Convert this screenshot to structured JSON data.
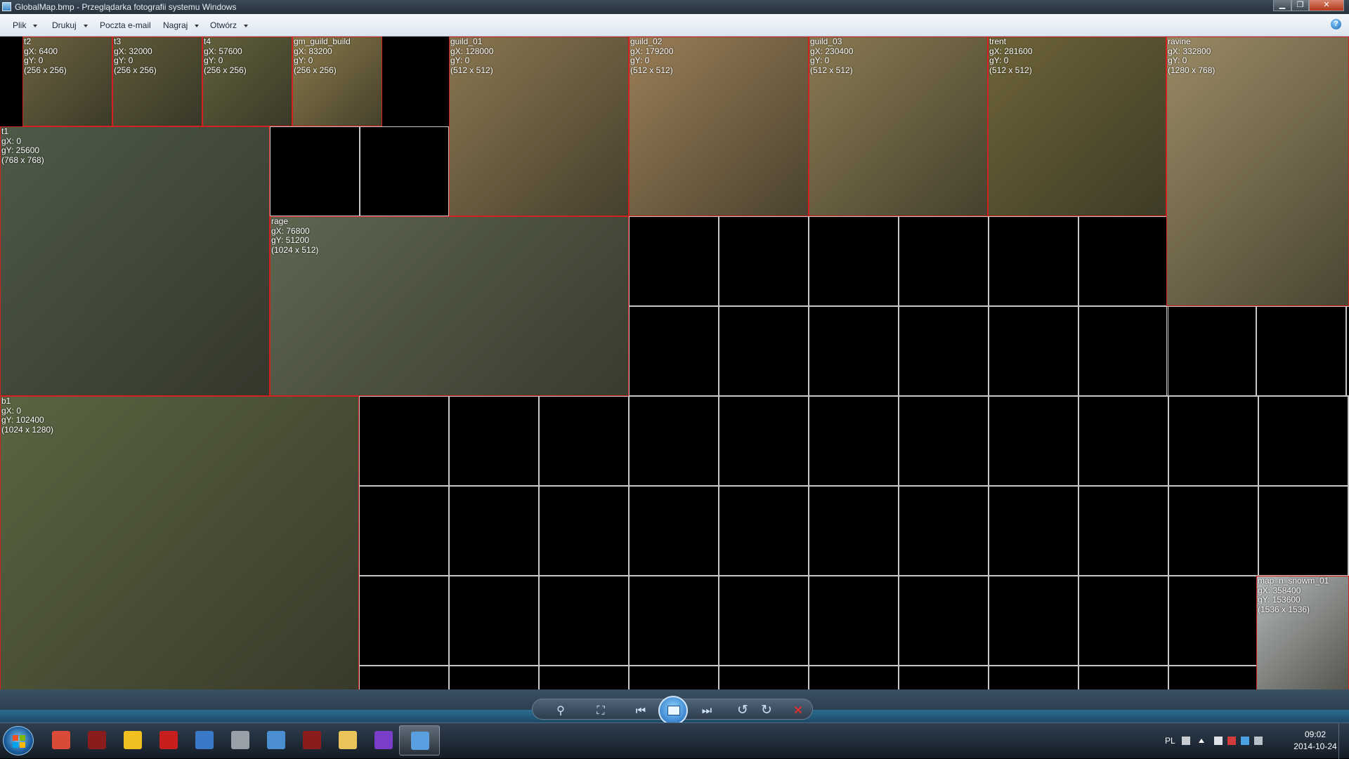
{
  "window": {
    "title": "GlobalMap.bmp - Przeglądarka fotografii systemu Windows",
    "minimize_glyph": "▁",
    "maximize_glyph": "❐",
    "close_glyph": "✕"
  },
  "menu": {
    "items": [
      {
        "label": "Plik",
        "has_dropdown": true
      },
      {
        "label": "Drukuj",
        "has_dropdown": true
      },
      {
        "label": "Poczta e-mail",
        "has_dropdown": false
      },
      {
        "label": "Nagraj",
        "has_dropdown": true
      },
      {
        "label": "Otwórz",
        "has_dropdown": true
      }
    ],
    "help_glyph": "?"
  },
  "maps": [
    {
      "name": "t2",
      "gx": "gX: 6400",
      "gy": "gY: 0",
      "size": "(256 x 256)",
      "color": "#6b6240"
    },
    {
      "name": "t3",
      "gx": "gX: 32000",
      "gy": "gY: 0",
      "size": "(256 x 256)",
      "color": "#5f5a3a"
    },
    {
      "name": "t4",
      "gx": "gX: 57600",
      "gy": "gY: 0",
      "size": "(256 x 256)",
      "color": "#62603c"
    },
    {
      "name": "gm_guild_build",
      "gx": "gX: 83200",
      "gy": "gY: 0",
      "size": "(256 x 256)",
      "color": "#8a7a4a"
    },
    {
      "name": "guild_01",
      "gx": "gX: 128000",
      "gy": "gY: 0",
      "size": "(512 x 512)",
      "color": "#8a7650"
    },
    {
      "name": "guild_02",
      "gx": "gX: 179200",
      "gy": "gY: 0",
      "size": "(512 x 512)",
      "color": "#9a7e56"
    },
    {
      "name": "guild_03",
      "gx": "gX: 230400",
      "gy": "gY: 0",
      "size": "(512 x 512)",
      "color": "#8a7a52"
    },
    {
      "name": "trent",
      "gx": "gX: 281600",
      "gy": "gY: 0",
      "size": "(512 x 512)",
      "color": "#6e6438"
    },
    {
      "name": "ravine",
      "gx": "gX: 332800",
      "gy": "gY: 0",
      "size": "(1280 x 768)",
      "color": "#9a8a64"
    },
    {
      "name": "t1",
      "gx": "gX: 0",
      "gy": "gY: 25600",
      "size": "(768 x 768)",
      "color": "#4e5a48"
    },
    {
      "name": "rage",
      "gx": "gX: 76800",
      "gy": "gY: 51200",
      "size": "(1024 x 512)",
      "color": "#5e6650"
    },
    {
      "name": "b1",
      "gx": "gX: 0",
      "gy": "gY: 102400",
      "size": "(1024 x 1280)",
      "color": "#5a6442"
    },
    {
      "name": "map_n_snowm_01",
      "gx": "gX: 358400",
      "gy": "gY: 153600",
      "size": "(1536 x 1536)",
      "color": "#b4b8b8"
    }
  ],
  "toolbar": {
    "zoom_glyph": "⚲",
    "fit_glyph": "⛶",
    "prev_glyph": "⏮",
    "next_glyph": "⏭",
    "rotate_left_glyph": "↺",
    "rotate_right_glyph": "↻",
    "delete_glyph": "✕",
    "delete_color": "#e03030"
  },
  "taskbar": {
    "apps": [
      {
        "name": "chrome",
        "color": "#d94a38"
      },
      {
        "name": "game-client",
        "color": "#8a1c1c"
      },
      {
        "name": "bird-app",
        "color": "#f0c020"
      },
      {
        "name": "filezilla",
        "color": "#c81e1e"
      },
      {
        "name": "network-tool",
        "color": "#3a78c8"
      },
      {
        "name": "wolf-app",
        "color": "#9aa0a8"
      },
      {
        "name": "remote-desktop",
        "color": "#4a8ed0"
      },
      {
        "name": "game-client-2",
        "color": "#8a1c1c"
      },
      {
        "name": "explorer",
        "color": "#e8c45a"
      },
      {
        "name": "visual-studio",
        "color": "#7a3ec8"
      },
      {
        "name": "photo-viewer",
        "color": "#5aa0e0"
      }
    ],
    "language": "PL",
    "time": "09:02",
    "date": "2014-10-24"
  }
}
